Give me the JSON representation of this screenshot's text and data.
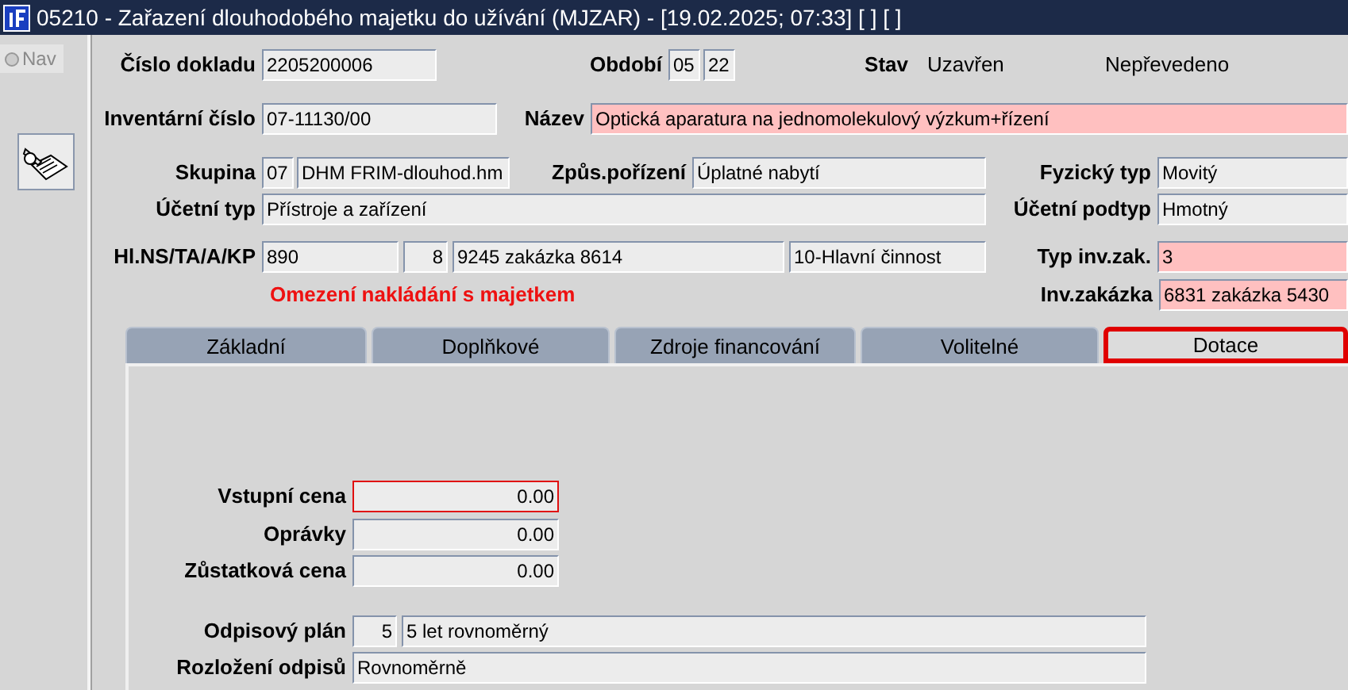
{
  "window": {
    "title": "05210 - Zařazení dlouhodobého majetku do užívání (MJZAR) - [19.02.2025; 07:33]  [ ]  [ ]"
  },
  "sidebar": {
    "nav": {
      "label": "Nav",
      "selected": false
    }
  },
  "header": {
    "cislo_dokladu": {
      "label": "Číslo dokladu",
      "value": "2205200006"
    },
    "obdobi": {
      "label": "Období",
      "month": "05",
      "year": "22"
    },
    "stav": {
      "label": "Stav",
      "value": "Uzavřen",
      "transfer": "Nepřevedeno"
    },
    "inventarni_cislo": {
      "label": "Inventární číslo",
      "value": "07-11130/00"
    },
    "nazev": {
      "label": "Název",
      "value": "Optická aparatura na jednomolekulový výzkum+řízení",
      "required": true
    },
    "skupina": {
      "label": "Skupina",
      "code": "07",
      "value": "DHM FRIM-dlouhod.hm"
    },
    "zpusob_porizeni": {
      "label": "Způs.pořízení",
      "value": "Úplatné nabytí"
    },
    "fyzicky_typ": {
      "label": "Fyzický typ",
      "value": "Movitý"
    },
    "ucetni_typ": {
      "label": "Účetní typ",
      "value": "Přístroje a zařízení"
    },
    "ucetni_podtyp": {
      "label": "Účetní podtyp",
      "value": "Hmotný"
    },
    "hlns": {
      "label": "Hl.NS/TA/A/KP",
      "ns": "890",
      "ta": "8",
      "a": "9245 zakázka 8614",
      "kp": "10-Hlavní činnost"
    },
    "typ_inv_zak": {
      "label": "Typ inv.zak.",
      "value": "3",
      "required": true
    },
    "warning": "Omezení nakládání s majetkem",
    "inv_zakazka": {
      "label": "Inv.zakázka",
      "value": "6831 zakázka 5430",
      "required": true
    }
  },
  "tabs": [
    {
      "label": "Základní",
      "selected": false
    },
    {
      "label": "Doplňkové",
      "selected": false
    },
    {
      "label": "Zdroje financování",
      "selected": false
    },
    {
      "label": "Volitelné",
      "selected": false
    },
    {
      "label": "Dotace",
      "selected": true
    }
  ],
  "tab_panel": {
    "vstupni_cena": {
      "label": "Vstupní cena",
      "value": "0.00",
      "focused": true
    },
    "opravky": {
      "label": "Oprávky",
      "value": "0.00",
      "focused": false
    },
    "zustatkova_cena": {
      "label": "Zůstatková cena",
      "value": "0.00",
      "focused": false
    },
    "odpisovy_plan": {
      "label": "Odpisový plán",
      "code": "5",
      "value": "5 let rovnoměrný"
    },
    "rozlozeni_odpisu": {
      "label": "Rozložení odpisů",
      "value": "Rovnoměrně"
    }
  }
}
